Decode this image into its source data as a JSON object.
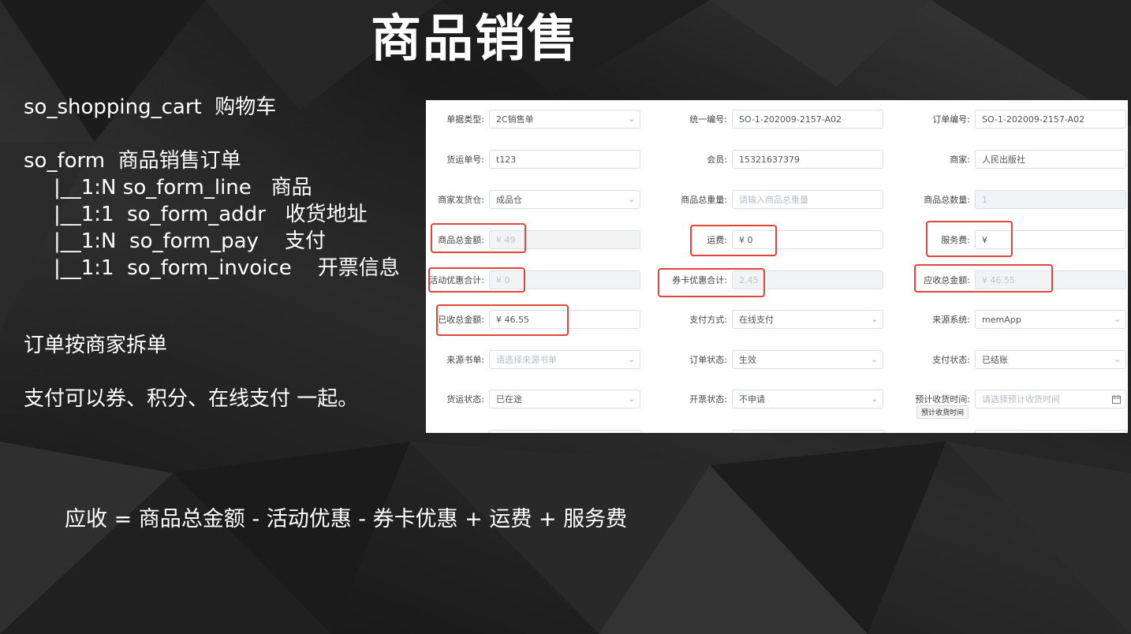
{
  "slide": {
    "title": "商品销售",
    "lines": [
      "so_shopping_cart  购物车",
      "so_form  商品销售订单",
      "|__1:N so_form_line   商品",
      "|__1:1  so_form_addr   收货地址",
      "|__1:N  so_form_pay    支付",
      "|__1:1  so_form_invoice    开票信息",
      "订单按商家拆单",
      "支付可以券、积分、在线支付 一起。"
    ],
    "formula": "应收 = 商品总金额 - 活动优惠 - 券卡优惠 + 运费 + 服务费"
  },
  "form": {
    "fields": [
      {
        "label": "单据类型:",
        "value": "2C销售单",
        "arrow": "⌄"
      },
      {
        "label": "统一编号:",
        "value": "SO-1-202009-2157-A02"
      },
      {
        "label": "订单编号:",
        "value": "SO-1-202009-2157-A02"
      },
      {
        "label": "货运单号:",
        "value": "t123"
      },
      {
        "label": "会员:",
        "value": "15321637379"
      },
      {
        "label": "商家:",
        "value": "人民出版社"
      },
      {
        "label": "商家发货仓:",
        "value": "成品仓",
        "arrow": "⌄"
      },
      {
        "label": "商品总重量:",
        "placeholder": "请输入商品总重量"
      },
      {
        "label": "商品总数量:",
        "value": "1"
      },
      {
        "label": "商品总金额:",
        "value": "¥ 49"
      },
      {
        "label": "运费:",
        "value": "¥ 0"
      },
      {
        "label": "服务费:",
        "value": "¥"
      },
      {
        "label": "活动优惠合计:",
        "value": "¥ 0"
      },
      {
        "label": "券卡优惠合计:",
        "value": "2.45"
      },
      {
        "label": "应收总金额:",
        "value": "¥ 46.55"
      },
      {
        "label": "已收总金额:",
        "value": "¥ 46.55"
      },
      {
        "label": "支付方式:",
        "value": "在线支付",
        "arrow": "⌄"
      },
      {
        "label": "来源系统:",
        "value": "memApp",
        "arrow": "⌄"
      },
      {
        "label": "来源书单:",
        "placeholder": "请选择来源书单",
        "arrow": "⌄"
      },
      {
        "label": "订单状态:",
        "value": "生效",
        "arrow": "⌄"
      },
      {
        "label": "支付状态:",
        "value": "已结账",
        "arrow": "⌄"
      },
      {
        "label": "货运状态:",
        "value": "已在途",
        "arrow": "⌄"
      },
      {
        "label": "开票状态:",
        "value": "不申请",
        "arrow": "⌄"
      },
      {
        "label": "预计收货时间:",
        "placeholder": "请选择预计收货时间",
        "icon": "calendar-icon"
      }
    ],
    "tooltip": "预计收货时间",
    "colors": {
      "highlight": "#e0463a",
      "border": "#dcdfe6",
      "disabled": "#f2f3f5"
    }
  }
}
